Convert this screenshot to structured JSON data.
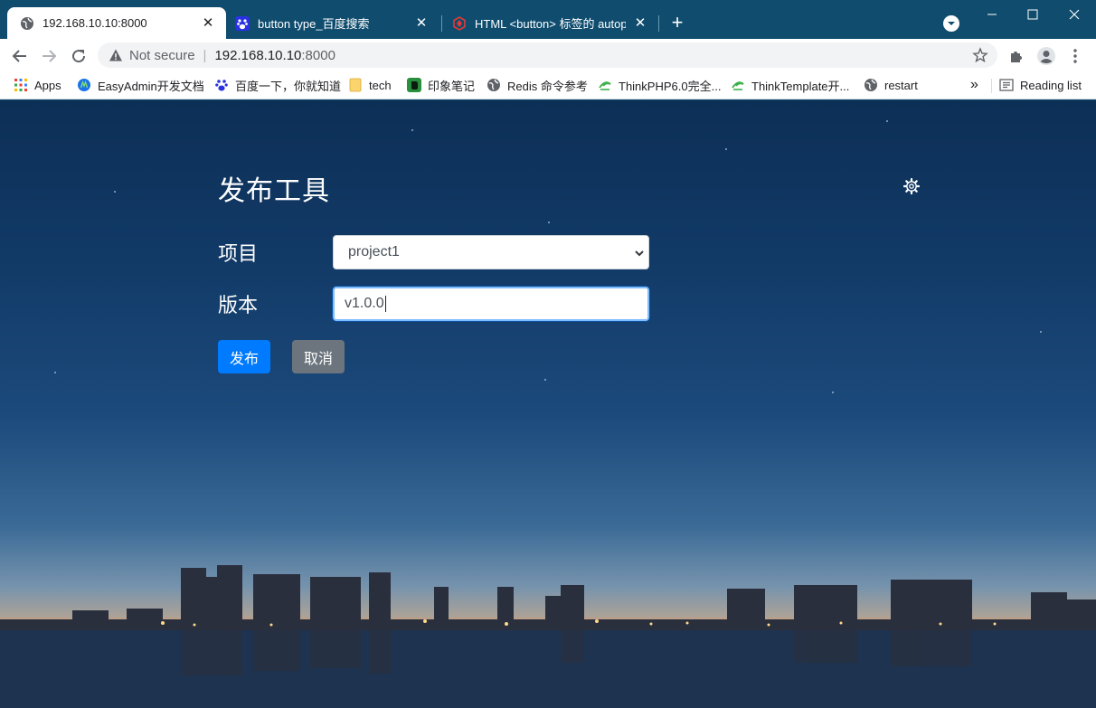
{
  "browser": {
    "tabs": [
      {
        "title": "192.168.10.10:8000",
        "icon": "globe-icon",
        "active": true
      },
      {
        "title": "button type_百度搜索",
        "icon": "baidu-paw-icon",
        "active": false
      },
      {
        "title": "HTML <button> 标签的 autopl",
        "icon": "w3-logo-icon",
        "active": false
      }
    ],
    "omnibox": {
      "security_label": "Not secure",
      "host": "192.168.10.10",
      "port": ":8000"
    },
    "bookmarks": [
      {
        "label": "Apps",
        "icon": "apps-grid-icon"
      },
      {
        "label": "EasyAdmin开发文档",
        "icon": "easyadmin-icon"
      },
      {
        "label": "百度一下，你就知道",
        "icon": "baidu-paw-icon"
      },
      {
        "label": "tech",
        "icon": "folder-icon"
      },
      {
        "label": "印象笔记",
        "icon": "evernote-icon"
      },
      {
        "label": "Redis 命令参考",
        "icon": "globe-icon"
      },
      {
        "label": "ThinkPHP6.0完全...",
        "icon": "thinkphp-icon"
      },
      {
        "label": "ThinkTemplate开...",
        "icon": "thinkphp-icon"
      },
      {
        "label": "restart",
        "icon": "globe-icon"
      }
    ],
    "overflow_label": "»",
    "reading_list_label": "Reading list",
    "colors": {
      "frame": "#0f4c6e",
      "accent": "#007bff"
    }
  },
  "page": {
    "title": "发布工具",
    "settings_icon": "gear-icon",
    "form": {
      "project_label": "项目",
      "project_value": "project1",
      "version_label": "版本",
      "version_value": "v1.0.0"
    },
    "buttons": {
      "publish": "发布",
      "cancel": "取消"
    }
  }
}
